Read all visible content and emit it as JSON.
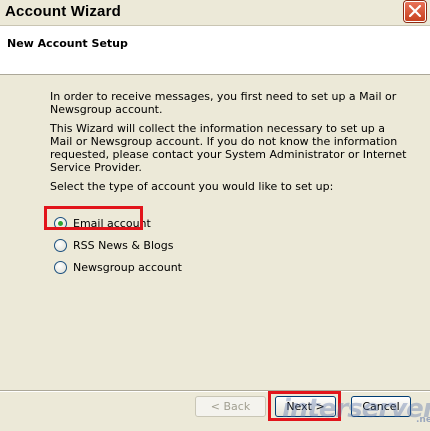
{
  "window": {
    "title": "Account Wizard"
  },
  "header": {
    "title": "New Account Setup"
  },
  "content": {
    "paragraphs": [
      "In order to receive messages, you first need to set up a Mail or Newsgroup account.",
      "This Wizard will collect the information necessary to set up a Mail or Newsgroup account. If you do not know the information requested, please contact your System Administrator or Internet Service Provider.",
      "Select the type of account you would like to set up:"
    ]
  },
  "account_types": {
    "selected": "Email account",
    "options": [
      {
        "label": "Email account",
        "checked": true
      },
      {
        "label": "RSS News & Blogs",
        "checked": false
      },
      {
        "label": "Newsgroup account",
        "checked": false
      }
    ]
  },
  "buttons": {
    "back": "< Back",
    "next": "Next >",
    "cancel": "Cancel"
  },
  "watermark": {
    "text": "interserver",
    "suffix": ".net"
  },
  "colors": {
    "highlight": "#e2141b",
    "radio_checked": "#31a233",
    "window_bg": "#ece9d8",
    "close_button": "#c8411f"
  },
  "icons": {
    "close": "close-x-icon"
  }
}
